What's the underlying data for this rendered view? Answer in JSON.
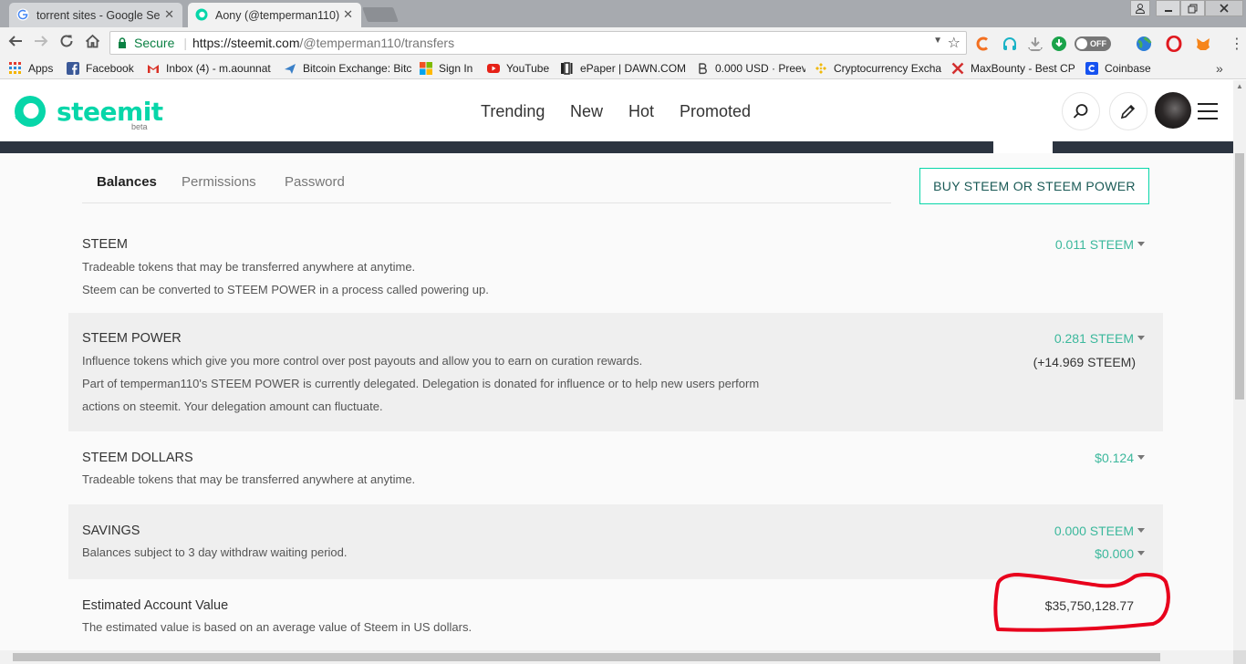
{
  "browser": {
    "tabs": [
      {
        "title": "torrent sites - Google Se",
        "favicon": "google-icon",
        "active": false
      },
      {
        "title": "Aony (@temperman110)",
        "favicon": "steemit-icon",
        "active": true
      }
    ],
    "address": {
      "secure_label": "Secure",
      "url_host": "https://steemit.com",
      "url_path": "/@temperman110/transfers"
    },
    "toggle_label": "OFF",
    "bookmarks": [
      {
        "label": "Apps",
        "icon": "apps-grid-icon",
        "color": "#e23a2e"
      },
      {
        "label": "Facebook",
        "icon": "facebook-icon",
        "color": "#3b5998"
      },
      {
        "label": "Inbox (4) - m.aounnat",
        "icon": "gmail-icon",
        "color": "#d93025"
      },
      {
        "label": "Bitcoin Exchange: Bitc",
        "icon": "plane-icon",
        "color": "#3a80c8"
      },
      {
        "label": "Sign In",
        "icon": "microsoft-icon",
        "color": "#f25022"
      },
      {
        "label": "YouTube",
        "icon": "youtube-icon",
        "color": "#e62117"
      },
      {
        "label": "ePaper | DAWN.COM",
        "icon": "dawn-icon",
        "color": "#222222"
      },
      {
        "label": "0.000 USD · Preev",
        "icon": "bitcoin-icon",
        "color": "#444444"
      },
      {
        "label": "Cryptocurrency Excha",
        "icon": "binance-icon",
        "color": "#f0b90b"
      },
      {
        "label": "MaxBounty - Best CP",
        "icon": "maxbounty-icon",
        "color": "#d32f2f"
      },
      {
        "label": "Coinbase",
        "icon": "coinbase-icon",
        "color": "#1652f0"
      }
    ]
  },
  "header": {
    "logo_text": "steemit",
    "logo_beta": "beta",
    "nav": [
      "Trending",
      "New",
      "Hot",
      "Promoted"
    ],
    "brand_color": "#07d6a9"
  },
  "wallet": {
    "tabs": [
      "Balances",
      "Permissions",
      "Password"
    ],
    "buy_button": "BUY STEEM OR STEEM POWER",
    "rows": [
      {
        "title": "STEEM",
        "desc": [
          "Tradeable tokens that may be transferred anywhere at anytime.",
          "Steem can be converted to STEEM POWER in a process called powering up."
        ],
        "amount": "0.011 STEEM"
      },
      {
        "title": "STEEM POWER",
        "desc": [
          "Influence tokens which give you more control over post payouts and allow you to earn on curation rewards.",
          "Part of temperman110's STEEM POWER is currently delegated. Delegation is donated for influence or to help new users perform",
          "actions on steemit. Your delegation amount can fluctuate."
        ],
        "amount": "0.281 STEEM",
        "delegated": "(+14.969 STEEM)"
      },
      {
        "title": "STEEM DOLLARS",
        "desc": [
          "Tradeable tokens that may be transferred anywhere at anytime."
        ],
        "amount": "$0.124"
      },
      {
        "title": "SAVINGS",
        "desc": [
          "Balances subject to 3 day withdraw waiting period."
        ],
        "amount": "0.000 STEEM",
        "amount2": "$0.000"
      },
      {
        "title": "Estimated Account Value",
        "desc": [
          "The estimated value is based on an average value of Steem in US dollars."
        ],
        "amount": "$35,750,128.77"
      }
    ],
    "amount_color": "#3bb89c",
    "highlight_color": "#e8001c"
  }
}
